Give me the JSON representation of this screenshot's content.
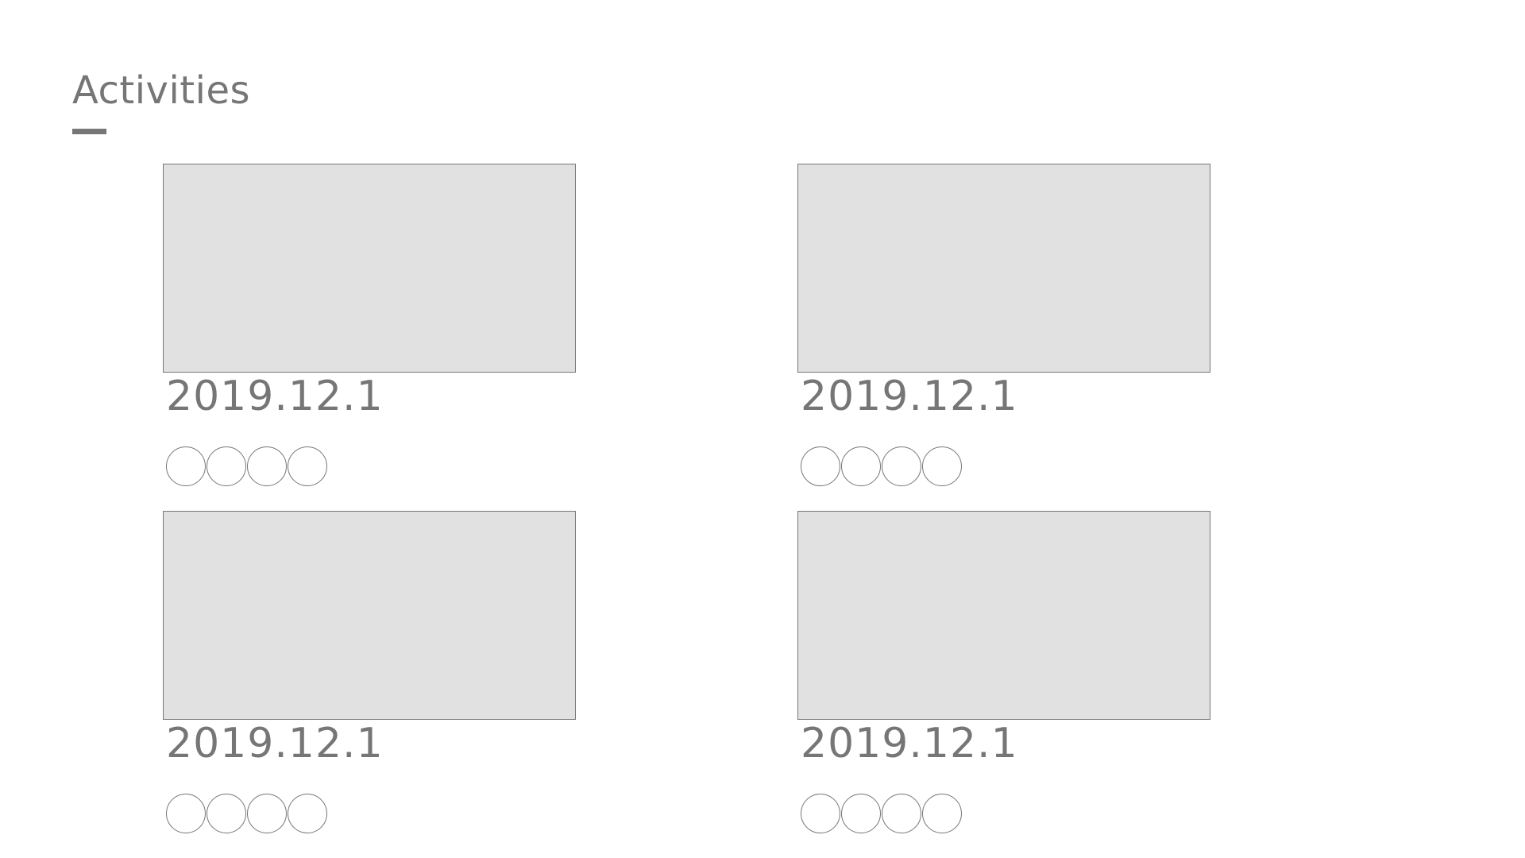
{
  "section": {
    "title": "Activities"
  },
  "colors": {
    "text": "#767676",
    "placeholder_fill": "#e1e1e1",
    "border": "#767676"
  },
  "activities": [
    {
      "image_icon": "image-placeholder-icon",
      "date": "2019.12.1",
      "circle_glyph_count": 4
    },
    {
      "image_icon": "image-placeholder-icon",
      "date": "2019.12.1",
      "circle_glyph_count": 4
    },
    {
      "image_icon": "image-placeholder-icon",
      "date": "2019.12.1",
      "circle_glyph_count": 4
    },
    {
      "image_icon": "image-placeholder-icon",
      "date": "2019.12.1",
      "circle_glyph_count": 4
    }
  ]
}
